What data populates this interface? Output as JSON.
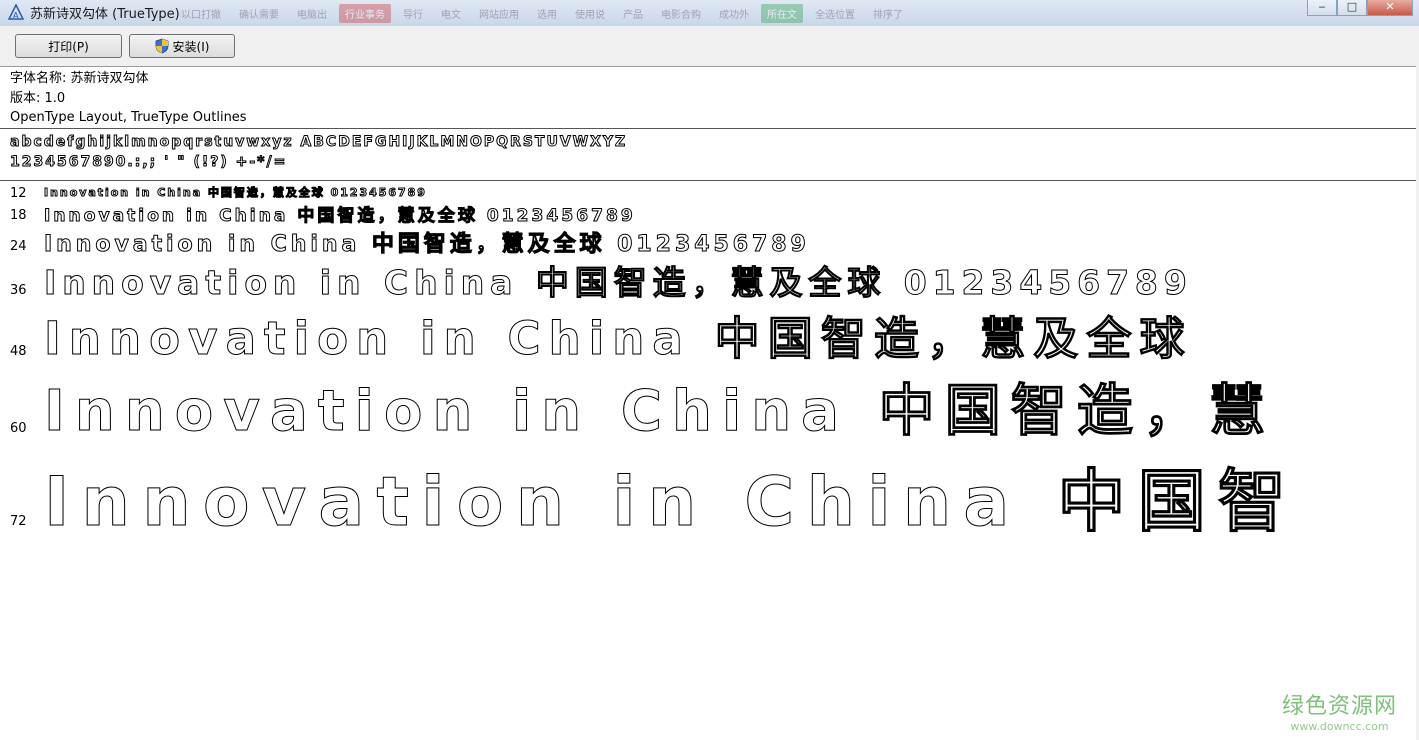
{
  "window": {
    "title": "苏新诗双勾体 (TrueType)",
    "taskbar_ghosts": [
      "以口打撤",
      "确认需要",
      "电脑出",
      "行业事务",
      "导行",
      "电文",
      "网站应用",
      "选用",
      "使用说",
      "产品",
      "电影合购",
      "成功外",
      "所在文",
      "全选位置",
      "排序了"
    ],
    "controls": {
      "minimize": "‒",
      "maximize": "□",
      "close": "✕"
    }
  },
  "toolbar": {
    "print_label": "打印(P)",
    "install_label": "安装(I)"
  },
  "info": {
    "font_name": "字体名称: 苏新诗双勾体",
    "version": "版本: 1.0",
    "format": "OpenType Layout, TrueType Outlines"
  },
  "charset": {
    "line1": "abcdefghijklmnopqrstuvwxyz ABCDEFGHIJKLMNOPQRSTUVWXYZ",
    "line2": "1234567890.:,; ' \" (!?) +-*/="
  },
  "samples": [
    {
      "size": "12",
      "text": "Innovation in China 中国智造，慧及全球 0123456789"
    },
    {
      "size": "18",
      "text": "Innovation in China 中国智造，慧及全球 0123456789"
    },
    {
      "size": "24",
      "text": "Innovation in China 中国智造，慧及全球 0123456789"
    },
    {
      "size": "36",
      "text": "Innovation in China 中国智造，慧及全球 0123456789"
    },
    {
      "size": "48",
      "text": "Innovation in China 中国智造，慧及全球"
    },
    {
      "size": "60",
      "text": "Innovation in China 中国智造，慧"
    },
    {
      "size": "72",
      "text": "Innovation in China 中国智"
    }
  ],
  "watermark": {
    "main": "绿色资源网",
    "sub": "www.downcc.com"
  },
  "colors": {
    "title_gradient_top": "#dfe8f3",
    "close_button": "#c9594a",
    "toolbar_bg": "#f0f0f0",
    "watermark_green": "#7fc07a"
  }
}
